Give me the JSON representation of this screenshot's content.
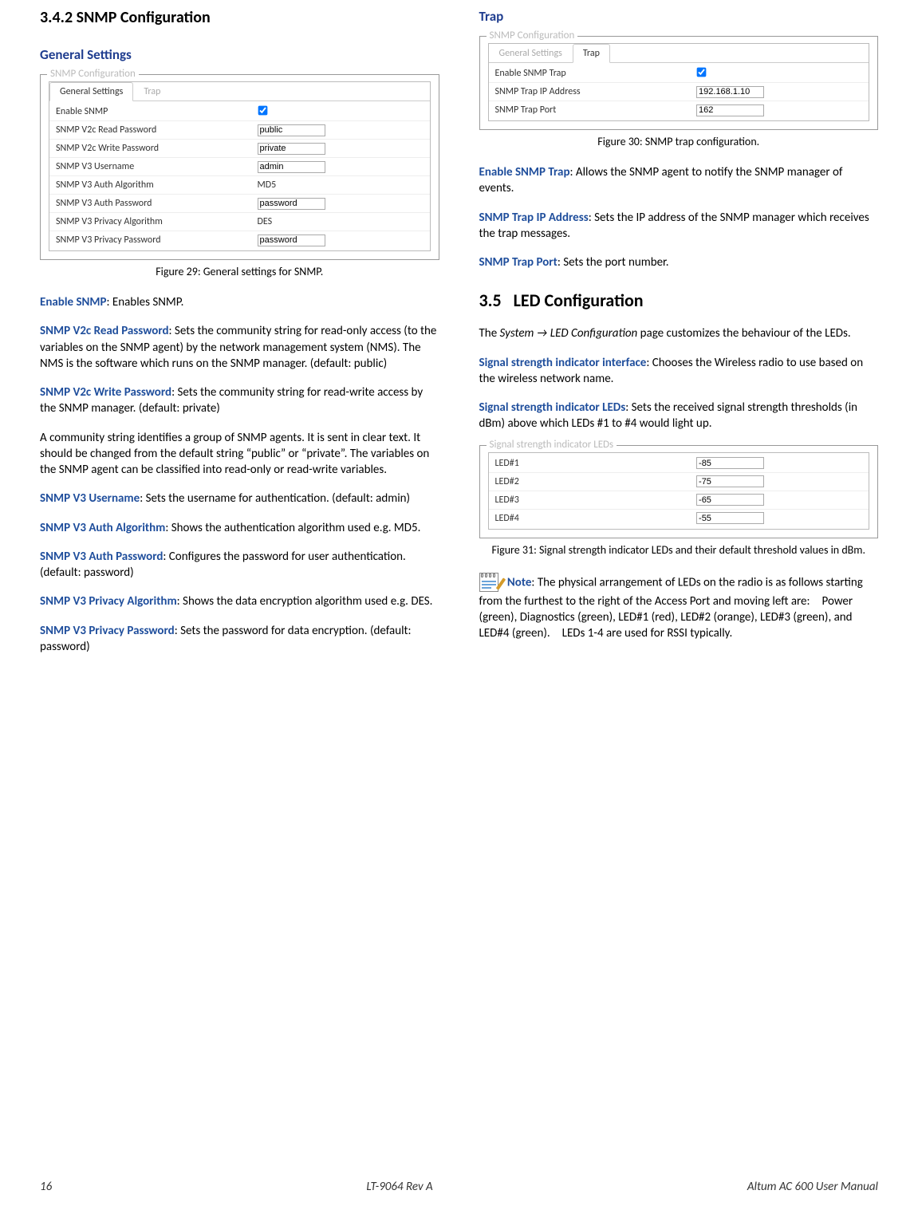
{
  "left": {
    "heading_num": "3.4.2",
    "heading_title": "SNMP Configuration",
    "sub_general": "General Settings",
    "fig29": {
      "legend": "SNMP Configuration",
      "tabs": [
        "General Settings",
        "Trap"
      ],
      "rows": [
        {
          "label": "Enable SNMP",
          "type": "check",
          "checked": true
        },
        {
          "label": "SNMP V2c Read Password",
          "type": "text",
          "value": "public"
        },
        {
          "label": "SNMP V2c Write Password",
          "type": "text",
          "value": "private"
        },
        {
          "label": "SNMP V3 Username",
          "type": "text",
          "value": "admin"
        },
        {
          "label": "SNMP V3 Auth Algorithm",
          "type": "static",
          "value": "MD5"
        },
        {
          "label": "SNMP V3 Auth Password",
          "type": "text",
          "value": "password"
        },
        {
          "label": "SNMP V3 Privacy Algorithm",
          "type": "static",
          "value": "DES"
        },
        {
          "label": "SNMP V3 Privacy Password",
          "type": "text",
          "value": "password"
        }
      ],
      "caption": "Figure 29: General settings for SNMP."
    },
    "paras": [
      {
        "term": "Enable SNMP",
        "text": ": Enables SNMP."
      },
      {
        "term": "SNMP V2c Read Password",
        "text": ": Sets the community string for read-only access (to the variables on the SNMP agent) by the network management system (NMS). The NMS is the software which runs on the SNMP manager. (default: public)"
      },
      {
        "term": "SNMP V2c Write Password",
        "text": ": Sets the community string for read-write access by the SNMP manager. (default: private)"
      },
      {
        "term": null,
        "text": "A community string identifies a group of SNMP agents. It is sent in clear text. It should be changed from the default string “public” or “private”. The variables on the SNMP agent can be classified into read-only or read-write variables."
      },
      {
        "term": "SNMP V3 Username",
        "text": ": Sets the username for authentication. (default: admin)"
      },
      {
        "term": "SNMP V3 Auth Algorithm",
        "text": ": Shows the authentication algorithm used e.g. MD5."
      },
      {
        "term": "SNMP V3 Auth Password",
        "text": ": Configures the password for user authentication. (default: password)"
      },
      {
        "term": "SNMP V3 Privacy Algorithm",
        "text": ": Shows the data encryption algorithm used e.g. DES."
      },
      {
        "term": "SNMP V3 Privacy Password",
        "text": ": Sets the password for data encryption. (default: password)"
      }
    ]
  },
  "right": {
    "sub_trap": "Trap",
    "fig30": {
      "legend": "SNMP Configuration",
      "tabs": [
        "General Settings",
        "Trap"
      ],
      "rows": [
        {
          "label": "Enable SNMP Trap",
          "type": "check",
          "checked": true
        },
        {
          "label": "SNMP Trap IP Address",
          "type": "text",
          "value": "192.168.1.10"
        },
        {
          "label": "SNMP Trap Port",
          "type": "text",
          "value": "162"
        }
      ],
      "caption": "Figure 30: SNMP trap configuration."
    },
    "paras1": [
      {
        "term": "Enable SNMP Trap",
        "text": ": Allows the SNMP agent to notify the SNMP manager of events."
      },
      {
        "term": "SNMP Trap IP Address",
        "text": ": Sets the IP address of the SNMP manager which receives the trap messages."
      },
      {
        "term": "SNMP Trap Port",
        "text": ": Sets the port number."
      }
    ],
    "section35_num": "3.5",
    "section35_title": "LED Configuration",
    "intro35_pre": "The ",
    "intro35_em": "System → LED Configuration",
    "intro35_post": " page customizes the behaviour of the LEDs.",
    "paras2": [
      {
        "term": "Signal strength indicator interface",
        "text": ": Chooses the Wireless radio to use based on the wireless network name."
      },
      {
        "term": "Signal strength indicator LEDs",
        "text": ": Sets the received signal strength thresholds (in dBm) above which LEDs #1 to #4 would light up."
      }
    ],
    "fig31": {
      "legend": "Signal strength indicator LEDs",
      "rows": [
        {
          "label": "LED#1",
          "type": "text",
          "value": "-85"
        },
        {
          "label": "LED#2",
          "type": "text",
          "value": "-75"
        },
        {
          "label": "LED#3",
          "type": "text",
          "value": "-65"
        },
        {
          "label": "LED#4",
          "type": "text",
          "value": "-55"
        }
      ],
      "caption": "Figure 31: Signal strength indicator LEDs and their default threshold values in dBm."
    },
    "note_term": "Note",
    "note_text": ": The physical arrangement of LEDs on the radio is as follows starting from the furthest to the right of the Access Port and moving left are: Power (green), Diagnostics (green), LED#1 (red), LED#2 (orange), LED#3 (green), and LED#4 (green). LEDs 1-4 are used for RSSI typically."
  },
  "footer": {
    "page": "16",
    "center": "LT-9064 Rev A",
    "right": "Altum AC 600 User Manual"
  }
}
